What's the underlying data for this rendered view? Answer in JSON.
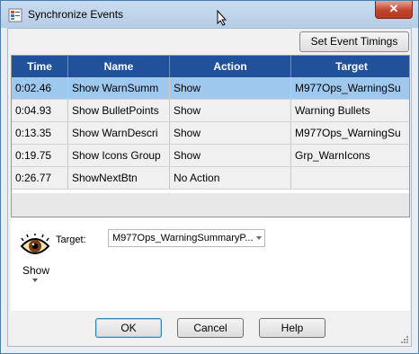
{
  "window": {
    "title": "Synchronize Events",
    "close_symbol": "✕"
  },
  "toolbar": {
    "set_event_timings_label": "Set Event Timings"
  },
  "table": {
    "columns": [
      "Time",
      "Name",
      "Action",
      "Target"
    ],
    "rows": [
      {
        "time": "0:02.46",
        "name": "Show WarnSumm",
        "action": "Show",
        "target": "M977Ops_WarningSu",
        "selected": true
      },
      {
        "time": "0:04.93",
        "name": "Show BulletPoints",
        "action": "Show",
        "target": "Warning Bullets",
        "selected": false
      },
      {
        "time": "0:13.35",
        "name": "Show WarnDescri",
        "action": "Show",
        "target": "M977Ops_WarningSu",
        "selected": false
      },
      {
        "time": "0:19.75",
        "name": "Show Icons Group",
        "action": "Show",
        "target": "Grp_WarnIcons",
        "selected": false
      },
      {
        "time": "0:26.77",
        "name": "ShowNextBtn",
        "action": "No Action",
        "target": "",
        "selected": false
      }
    ]
  },
  "action_panel": {
    "action_icon": "eye-icon",
    "action_label": "Show",
    "target_label": "Target:",
    "target_value": "M977Ops_WarningSummaryP..."
  },
  "buttons": {
    "ok": "OK",
    "cancel": "Cancel",
    "help": "Help"
  },
  "colors": {
    "header_bg": "#21519a",
    "selected_row": "#9fc8ef",
    "title_bar": "#b7cde6"
  }
}
